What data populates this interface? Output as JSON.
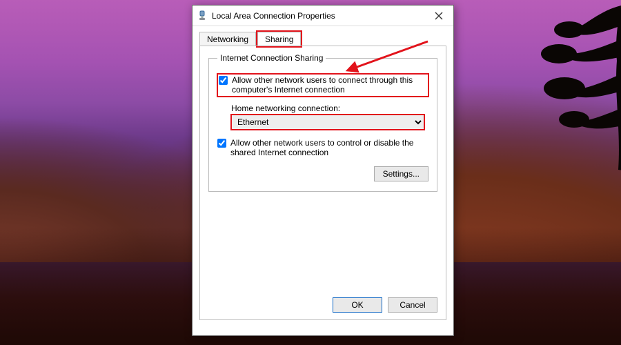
{
  "window": {
    "title": "Local Area Connection Properties"
  },
  "tabs": {
    "networking": "Networking",
    "sharing": "Sharing"
  },
  "group": {
    "legend": "Internet Connection Sharing",
    "allow_connect": "Allow other network users to connect through this computer's Internet connection",
    "home_label": "Home networking connection:",
    "home_value": "Ethernet",
    "allow_control": "Allow other network users to control or disable the shared Internet connection",
    "settings_btn": "Settings..."
  },
  "buttons": {
    "ok": "OK",
    "cancel": "Cancel"
  },
  "state": {
    "allow_connect_checked": true,
    "allow_control_checked": true
  },
  "annotation": {
    "color": "#e2131b"
  }
}
